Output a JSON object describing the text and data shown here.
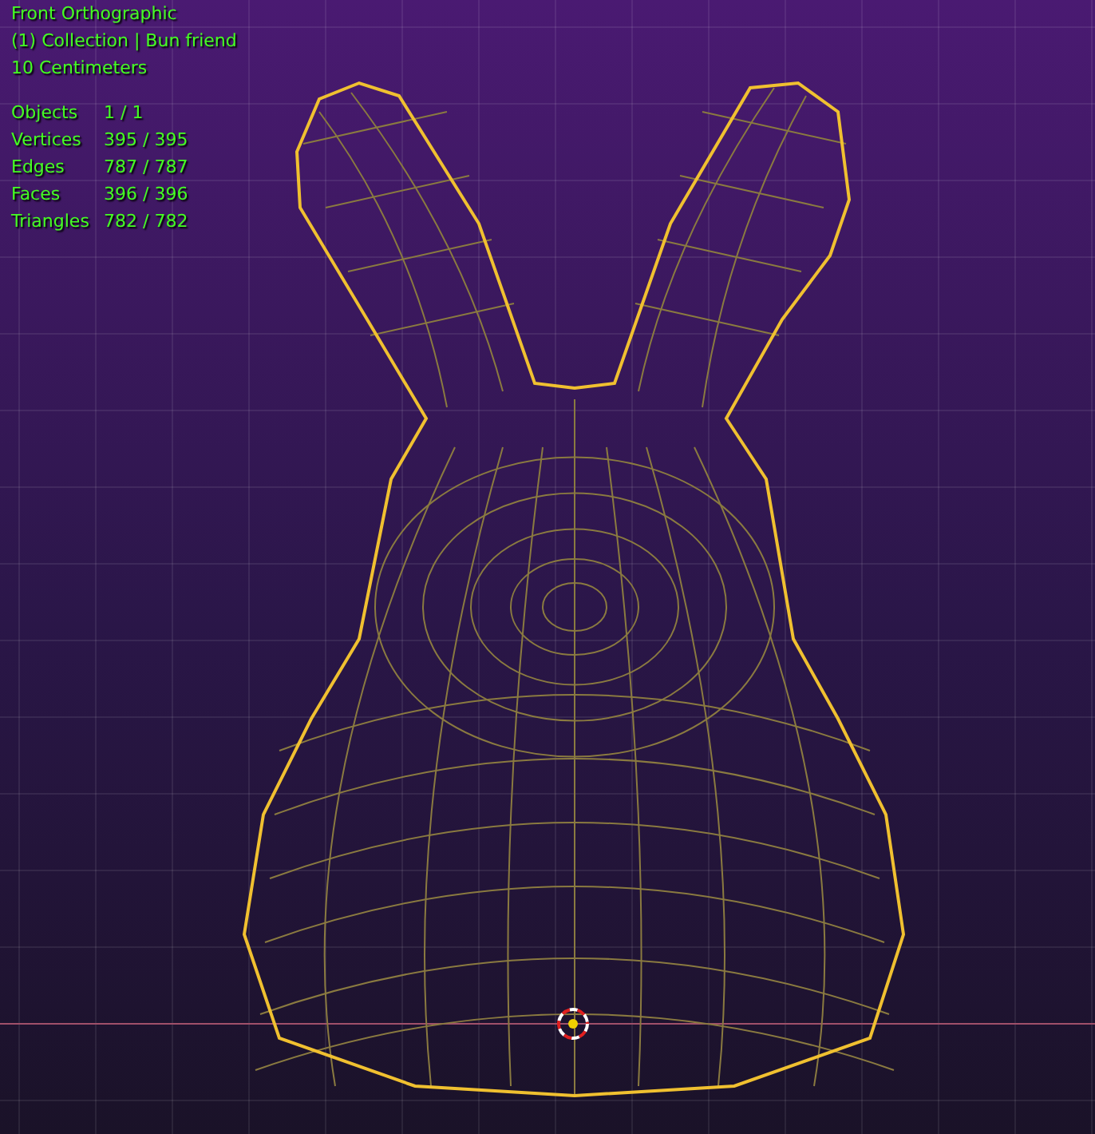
{
  "viewport": {
    "view_name": "Front Orthographic",
    "collection": "(1) Collection | Bun friend",
    "scale": "10 Centimeters",
    "stats": [
      {
        "label": "Objects",
        "value": "1 / 1"
      },
      {
        "label": "Vertices",
        "value": "395 / 395"
      },
      {
        "label": "Edges",
        "value": "787 / 787"
      },
      {
        "label": "Faces",
        "value": "396 / 396"
      },
      {
        "label": "Triangles",
        "value": "782 / 782"
      }
    ]
  }
}
